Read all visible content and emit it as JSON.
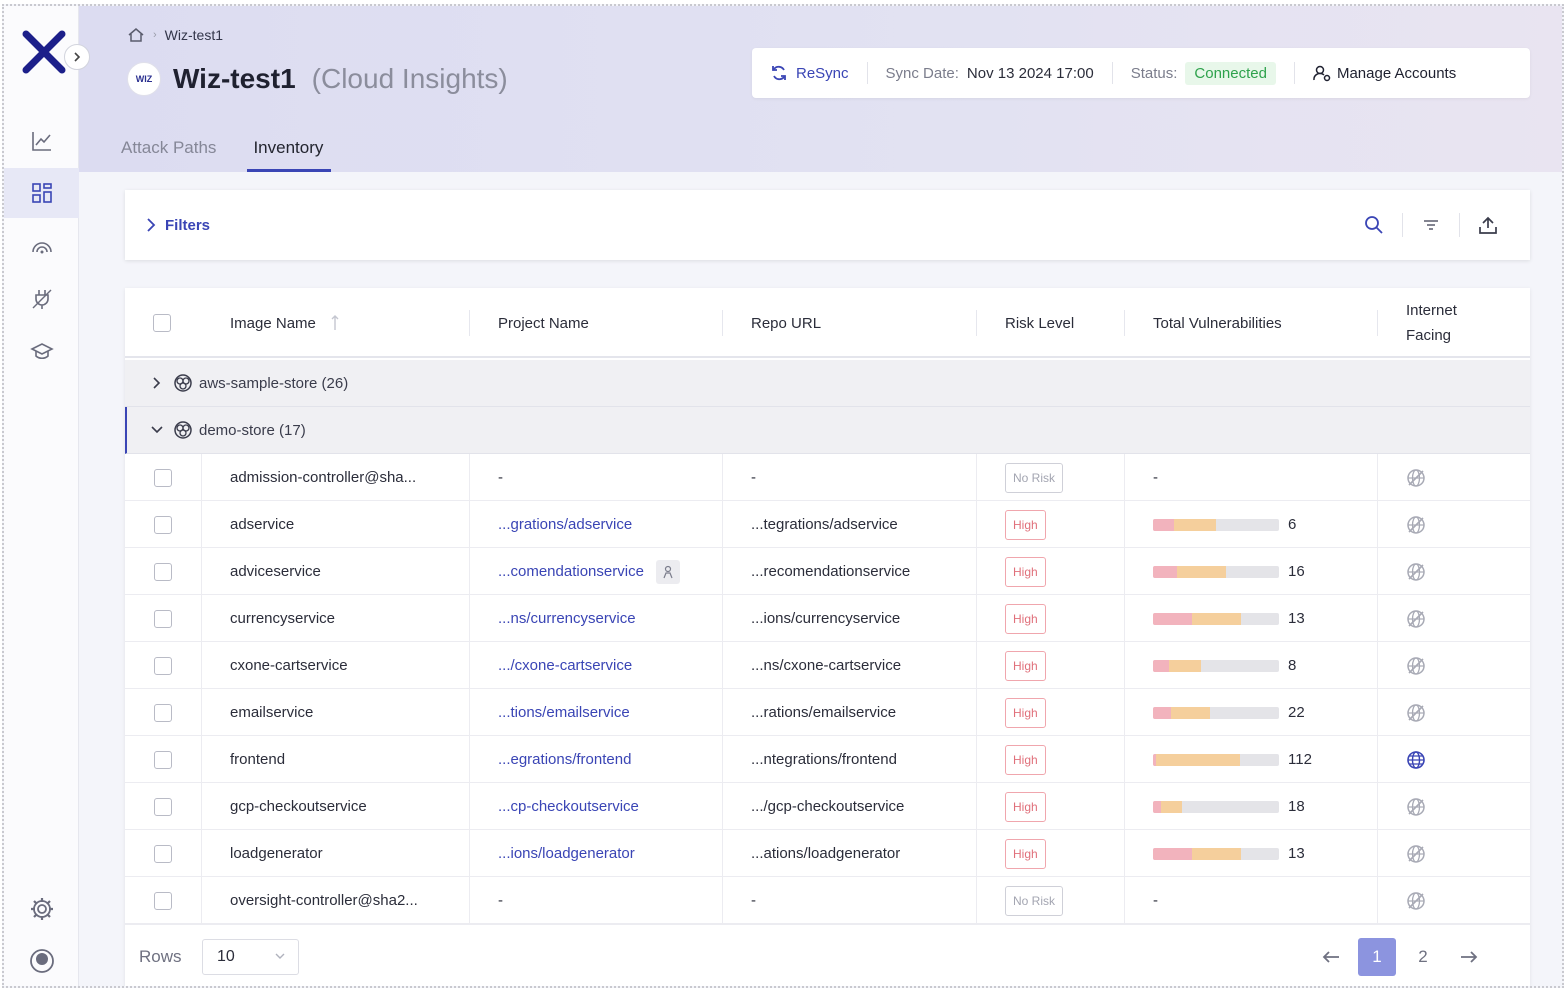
{
  "breadcrumb": {
    "current": "Wiz-test1"
  },
  "header": {
    "badge": "WIZ",
    "title": "Wiz-test1",
    "subtitle": "(Cloud Insights)",
    "resync_label": "ReSync",
    "sync_date_label": "Sync Date:",
    "sync_date_value": "Nov 13 2024 17:00",
    "status_label": "Status:",
    "status_value": "Connected",
    "manage_label": "Manage Accounts"
  },
  "tabs": [
    {
      "label": "Attack Paths",
      "active": false
    },
    {
      "label": "Inventory",
      "active": true
    }
  ],
  "filters": {
    "label": "Filters"
  },
  "table": {
    "columns": {
      "image_name": "Image Name",
      "project_name": "Project Name",
      "repo_url": "Repo URL",
      "risk_level": "Risk Level",
      "total_vulns": "Total Vulnerabilities",
      "internet_facing_1": "Internet",
      "internet_facing_2": "Facing"
    },
    "groups": [
      {
        "label": "aws-sample-store (26)",
        "expanded": false
      },
      {
        "label": "demo-store (17)",
        "expanded": true
      }
    ],
    "rows": [
      {
        "image": "admission-controller@sha...",
        "project": "-",
        "repo": "-",
        "risk": "No Risk",
        "vulns": "-",
        "bar": null,
        "internet": false
      },
      {
        "image": "adservice",
        "project": "...grations/adservice",
        "repo": "...tegrations/adservice",
        "risk": "High",
        "vulns": "6",
        "bar": [
          0.17,
          0.33
        ],
        "internet": false
      },
      {
        "image": "adviceservice",
        "project": "...comendationservice",
        "repo": "...recomendationservice",
        "risk": "High",
        "vulns": "16",
        "bar": [
          0.19,
          0.39
        ],
        "internet": false
      },
      {
        "image": "currencyservice",
        "project": "...ns/currencyservice",
        "repo": "...ions/currencyservice",
        "risk": "High",
        "vulns": "13",
        "bar": [
          0.31,
          0.39
        ],
        "internet": false
      },
      {
        "image": "cxone-cartservice",
        "project": ".../cxone-cartservice",
        "repo": "...ns/cxone-cartservice",
        "risk": "High",
        "vulns": "8",
        "bar": [
          0.13,
          0.25
        ],
        "internet": false
      },
      {
        "image": "emailservice",
        "project": "...tions/emailservice",
        "repo": "...rations/emailservice",
        "risk": "High",
        "vulns": "22",
        "bar": [
          0.14,
          0.31
        ],
        "internet": false
      },
      {
        "image": "frontend",
        "project": "...egrations/frontend",
        "repo": "...ntegrations/frontend",
        "risk": "High",
        "vulns": "112",
        "bar": [
          0.02,
          0.67
        ],
        "internet": true
      },
      {
        "image": "gcp-checkoutservice",
        "project": "...cp-checkoutservice",
        "repo": ".../gcp-checkoutservice",
        "risk": "High",
        "vulns": "18",
        "bar": [
          0.06,
          0.17
        ],
        "internet": false
      },
      {
        "image": "loadgenerator",
        "project": "...ions/loadgenerator",
        "repo": "...ations/loadgenerator",
        "risk": "High",
        "vulns": "13",
        "bar": [
          0.31,
          0.39
        ],
        "internet": false
      },
      {
        "image": "oversight-controller@sha2...",
        "project": "-",
        "repo": "-",
        "risk": "No Risk",
        "vulns": "-",
        "bar": null,
        "internet": false
      }
    ]
  },
  "pagination": {
    "rows_label": "Rows",
    "rows_value": "10",
    "pages": [
      "1",
      "2"
    ],
    "current_page": "1"
  },
  "colors": {
    "accent": "#3a45b5",
    "connected": "#2ea24c",
    "high_risk": "#e0707b",
    "bar_critical": "#f2b3bd",
    "bar_high": "#f5cf9c",
    "bar_rest": "#e4e4e8"
  }
}
